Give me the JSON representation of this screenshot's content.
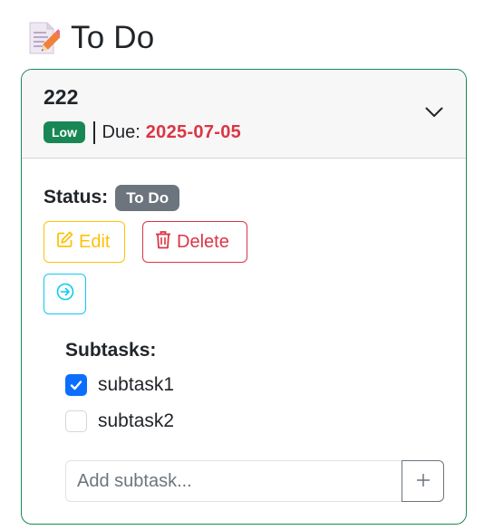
{
  "page": {
    "icon": "memo-pencil-icon",
    "title": "To Do"
  },
  "task": {
    "name": "222",
    "priority": "Low",
    "due_label": "Due:",
    "due_date": "2025-07-05",
    "status_label": "Status:",
    "status_value": "To Do",
    "actions": {
      "edit_label": "Edit",
      "delete_label": "Delete"
    },
    "subtasks_title": "Subtasks:",
    "subtasks": [
      {
        "label": "subtask1",
        "checked": true
      },
      {
        "label": "subtask2",
        "checked": false
      }
    ],
    "add_subtask_placeholder": "Add subtask...",
    "add_subtask_value": ""
  },
  "colors": {
    "card_border": "#198754",
    "priority_low": "#198754",
    "due_date": "#dc3545",
    "status_badge": "#6c757d",
    "edit": "#ffc107",
    "delete": "#dc3545",
    "move": "#0dcaf0",
    "checkbox_checked": "#0d6efd"
  }
}
